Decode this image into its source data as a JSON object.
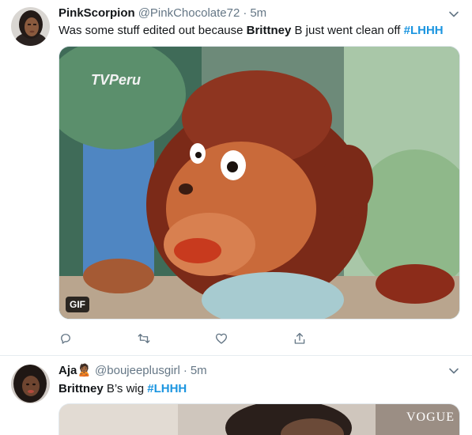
{
  "tweets": [
    {
      "display_name": "PinkScorpion",
      "handle": "@PinkChocolate72",
      "separator": "·",
      "time": "5m",
      "text": {
        "part1": "Was some stuff edited out because ",
        "bold": "Brittney",
        "part2": " B just went clean off ",
        "hashtag": "#LHHH"
      },
      "media": {
        "watermark": "TVPeru",
        "badge": "GIF"
      },
      "actions": [
        "reply-icon",
        "retweet-icon",
        "like-icon",
        "share-icon"
      ]
    },
    {
      "display_name": "Aja",
      "emoji": "🙎🏾",
      "handle": "@boujeeplusgirl",
      "separator": "·",
      "time": "5m",
      "text": {
        "bold": "Brittney",
        "part1": " B’s wig ",
        "hashtag": "#LHHH"
      },
      "media": {
        "watermark": "VOGUE"
      }
    }
  ],
  "colors": {
    "accent": "#1b95e0",
    "secondary_text": "#657786",
    "divider": "#e6ecf0"
  }
}
